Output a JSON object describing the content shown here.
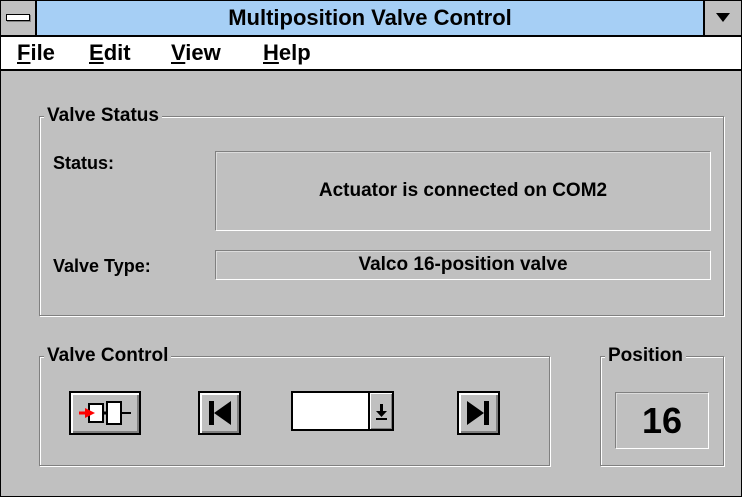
{
  "window": {
    "title": "Multiposition Valve Control"
  },
  "menubar": {
    "items": [
      {
        "hot": "F",
        "rest": "ile"
      },
      {
        "hot": "E",
        "rest": "dit"
      },
      {
        "hot": "V",
        "rest": "iew"
      },
      {
        "hot": "H",
        "rest": "elp"
      }
    ]
  },
  "valve_status": {
    "legend": "Valve Status",
    "status_label": "Status:",
    "status_value": "Actuator is connected on COM2",
    "type_label": "Valve Type:",
    "type_value": "Valco 16-position valve"
  },
  "valve_control": {
    "legend": "Valve Control",
    "position_select_value": ""
  },
  "position": {
    "legend": "Position",
    "value": "16"
  },
  "icons": {
    "connect": "valve-actuator-icon",
    "prev": "skip-to-start-icon",
    "next": "skip-to-end-icon",
    "dropdown": "dropdown-arrow-icon"
  },
  "colors": {
    "titlebar": "#a6cff5",
    "face": "#c0c0c0",
    "accent_red": "#ff0000"
  }
}
